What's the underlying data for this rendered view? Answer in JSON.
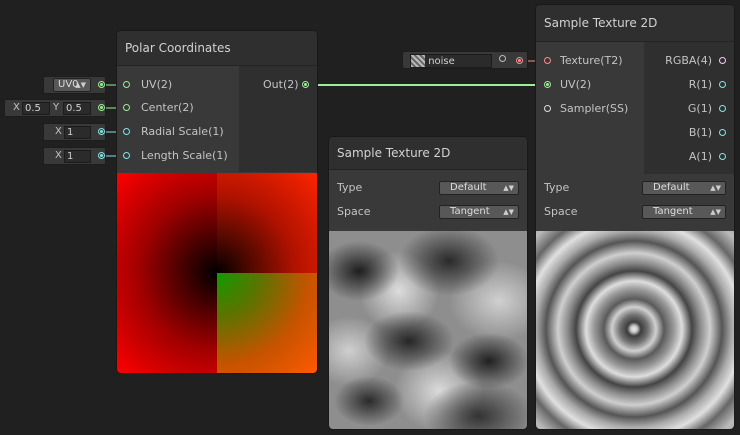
{
  "colors": {
    "background": "#202020",
    "node_body": "#393939",
    "node_header": "#2f2f2f",
    "port_vector2": "#9aef92",
    "port_vector1": "#84e4e7",
    "port_texture": "#ff8b8b",
    "port_sampler": "#dcdcdc",
    "port_vector4": "#fbcbf4"
  },
  "inline_inputs": {
    "uv_channel": "UV0",
    "center_x_label": "X",
    "center_x": "0.5",
    "center_y_label": "Y",
    "center_y": "0.5",
    "radial_x_label": "X",
    "radial_x": "1",
    "length_x_label": "X",
    "length_x": "1",
    "texture_name": "noise"
  },
  "polar_node": {
    "title": "Polar Coordinates",
    "inputs": [
      "UV(2)",
      "Center(2)",
      "Radial Scale(1)",
      "Length Scale(1)"
    ],
    "output": "Out(2)",
    "preview_icon": "polar-coordinates-preview"
  },
  "sample_node_mid": {
    "title": "Sample Texture 2D",
    "type_label": "Type",
    "type_value": "Default",
    "space_label": "Space",
    "space_value": "Tangent",
    "preview_icon": "noise-texture-preview"
  },
  "sample_node_right": {
    "title": "Sample Texture 2D",
    "inputs": [
      "Texture(T2)",
      "UV(2)",
      "Sampler(SS)"
    ],
    "outputs": [
      "RGBA(4)",
      "R(1)",
      "G(1)",
      "B(1)",
      "A(1)"
    ],
    "type_label": "Type",
    "type_value": "Default",
    "space_label": "Space",
    "space_value": "Tangent",
    "preview_icon": "swirl-texture-preview"
  }
}
